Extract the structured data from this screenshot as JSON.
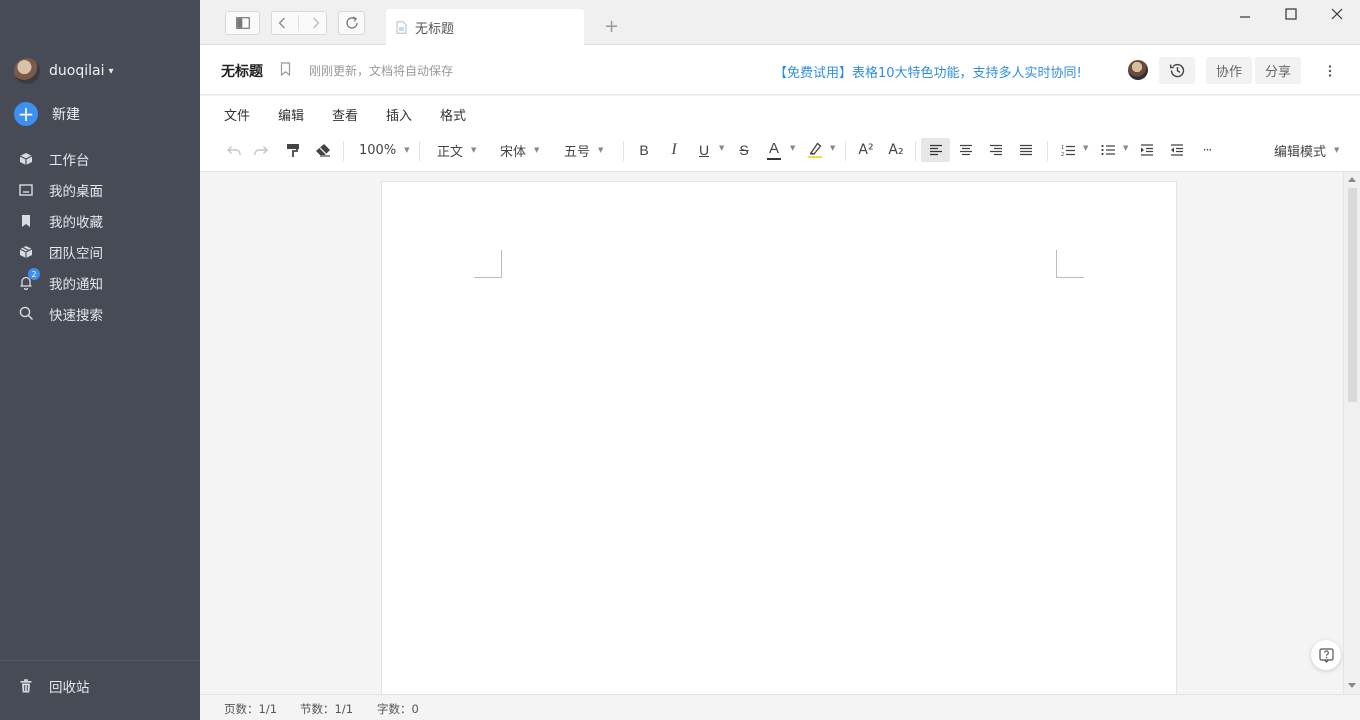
{
  "sidebar": {
    "user_name": "duoqilai",
    "caret": "▾",
    "new_label": "新建",
    "items": [
      {
        "label": "工作台"
      },
      {
        "label": "我的桌面"
      },
      {
        "label": "我的收藏"
      },
      {
        "label": "团队空间"
      },
      {
        "label": "我的通知",
        "badge": "2"
      },
      {
        "label": "快速搜索"
      }
    ],
    "trash_label": "回收站"
  },
  "tabs": [
    {
      "title": "无标题"
    }
  ],
  "new_tab_symbol": "+",
  "header": {
    "title": "无标题",
    "save_status": "刚刚更新，文档将自动保存",
    "promo": "【免费试用】表格10大特色功能，支持多人实时协同!",
    "collab_label": "协作",
    "share_label": "分享"
  },
  "menu": [
    "文件",
    "编辑",
    "查看",
    "插入",
    "格式"
  ],
  "toolbar": {
    "zoom": "100%",
    "paragraph_style": "正文",
    "font_family": "宋体",
    "font_size": "五号",
    "bold": "B",
    "italic": "I",
    "underline": "U",
    "strike": "S",
    "font_color_letter": "A",
    "superscript": "A²",
    "subscript": "A₂",
    "more": "···",
    "mode": "编辑模式",
    "font_color": "#333333",
    "highlight_color": "#f5d94a"
  },
  "statusbar": {
    "pages": "页数：1/1",
    "sections": "节数：1/1",
    "words": "字数：0"
  },
  "colors": {
    "sidebar_bg": "#474b55",
    "accent": "#3d8ff0",
    "promo": "#2f8ee0"
  }
}
